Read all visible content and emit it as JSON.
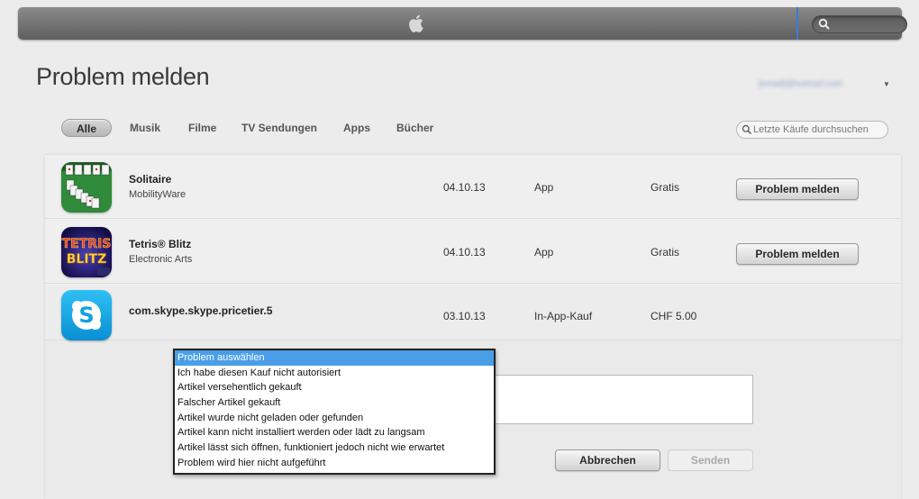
{
  "header": {
    "logo_icon": "apple-icon",
    "search_icon": "search-icon"
  },
  "page": {
    "title": "Problem melden",
    "account_email": "[email]@hotmail.com"
  },
  "tabs": [
    {
      "label": "Alle",
      "active": true
    },
    {
      "label": "Musik",
      "active": false
    },
    {
      "label": "Filme",
      "active": false
    },
    {
      "label": "TV Sendungen",
      "active": false
    },
    {
      "label": "Apps",
      "active": false
    },
    {
      "label": "Bücher",
      "active": false
    }
  ],
  "filter_search": {
    "placeholder": "Letzte Käufe durchsuchen"
  },
  "purchases": [
    {
      "name": "Solitaire",
      "developer": "MobilityWare",
      "date": "04.10.13",
      "type": "App",
      "price": "Gratis",
      "button": "Problem melden",
      "icon": "solitaire-app-icon"
    },
    {
      "name": "Tetris® Blitz",
      "developer": "Electronic Arts",
      "date": "04.10.13",
      "type": "App",
      "price": "Gratis",
      "button": "Problem melden",
      "icon": "tetris-app-icon"
    },
    {
      "name": "com.skype.skype.pricetier.5",
      "developer": "",
      "date": "03.10.13",
      "type": "In-App-Kauf",
      "price": "CHF 5.00",
      "icon": "skype-app-icon"
    }
  ],
  "report_form": {
    "options": [
      "Problem auswählen",
      "Ich habe diesen Kauf nicht autorisiert",
      "Artikel versehentlich gekauft",
      "Falscher Artikel gekauft",
      "Artikel wurde nicht geladen oder gefunden",
      "Artikel kann nicht installiert werden oder lädt zu langsam",
      "Artikel lässt sich öffnen, funktioniert jedoch nicht wie erwartet",
      "Problem wird hier nicht aufgeführt"
    ],
    "selected_index": 0,
    "cancel_label": "Abbrechen",
    "send_label": "Senden"
  },
  "colors": {
    "accent": "#4a9ee8",
    "topbar": "#6f6f6f"
  }
}
